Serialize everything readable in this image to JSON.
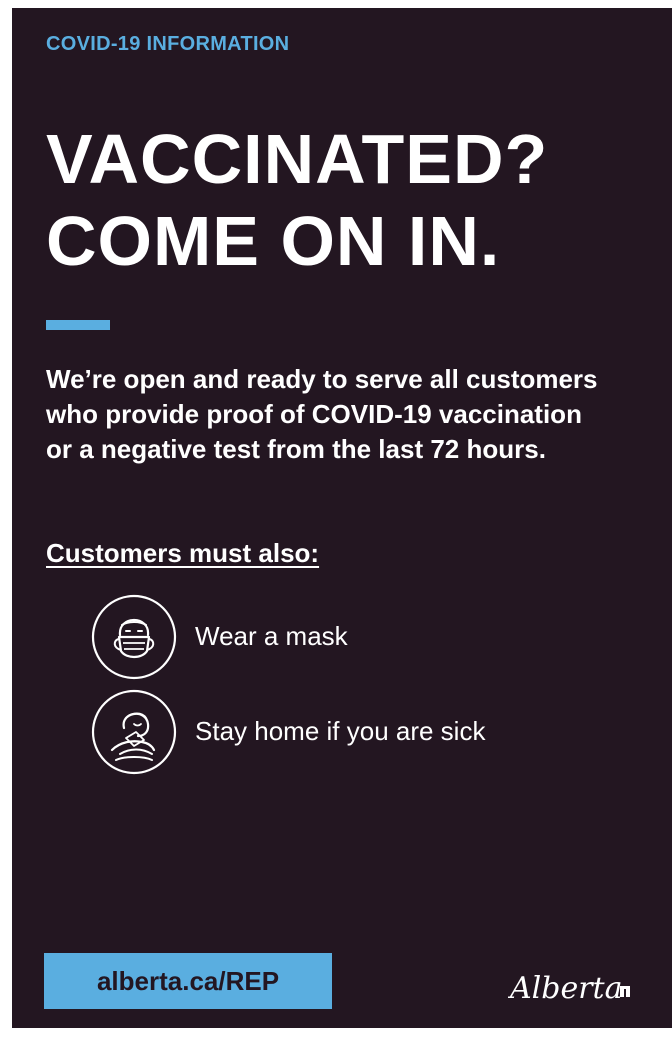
{
  "poster": {
    "eyebrow": "COVID-19 INFORMATION",
    "headline_line1": "VACCINATED?",
    "headline_line2": "COME ON IN.",
    "body": "We’re open and ready to serve all customers who provide proof of COVID-19 vaccination or a negative test from the last 72 hours.",
    "also_heading": "Customers must also:",
    "rules": [
      {
        "icon": "face-mask-icon",
        "label": "Wear a mask"
      },
      {
        "icon": "sick-person-icon",
        "label": "Stay home if you are sick"
      }
    ],
    "url": "alberta.ca/REP",
    "logo": "Alberta"
  },
  "colors": {
    "background": "#231621",
    "accent": "#5aaee0",
    "text": "#ffffff"
  }
}
